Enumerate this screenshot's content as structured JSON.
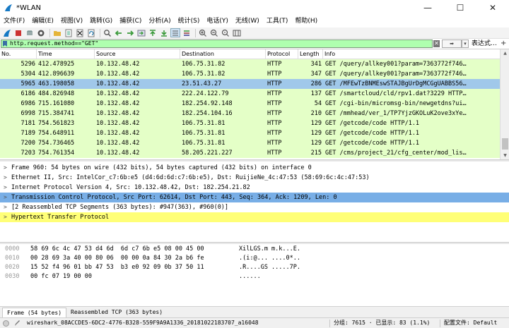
{
  "window": {
    "title": "*WLAN",
    "minimize": "—",
    "maximize": "☐",
    "close": "✕"
  },
  "menu": [
    "文件(F)",
    "编辑(E)",
    "视图(V)",
    "跳转(G)",
    "捕获(C)",
    "分析(A)",
    "统计(S)",
    "电话(Y)",
    "无线(W)",
    "工具(T)",
    "帮助(H)"
  ],
  "filter": {
    "value": "http.request.method==\"GET\"",
    "clear_label": "✕",
    "arrow_label": "➡",
    "dropdown_label": "▾",
    "expression_label": "表达式…",
    "plus_label": "+"
  },
  "columns": [
    "No.",
    "Time",
    "Source",
    "Destination",
    "Protocol",
    "Length",
    "Info"
  ],
  "packets": [
    {
      "no": "5296",
      "time": "412.478925",
      "src": "10.132.48.42",
      "dst": "106.75.31.82",
      "proto": "HTTP",
      "len": "341",
      "info": "GET /query/allkey001?param=7363772f746…",
      "selected": false
    },
    {
      "no": "5304",
      "time": "412.896639",
      "src": "10.132.48.42",
      "dst": "106.75.31.82",
      "proto": "HTTP",
      "len": "347",
      "info": "GET /query/allkey001?param=7363772f746…",
      "selected": false
    },
    {
      "no": "5965",
      "time": "463.198058",
      "src": "10.132.48.42",
      "dst": "23.51.43.27",
      "proto": "HTTP",
      "len": "286",
      "info": "GET /MFEwTzBNMEswSTAJBgUrDgMCGgUABBS56…",
      "selected": true
    },
    {
      "no": "6186",
      "time": "484.826948",
      "src": "10.132.48.42",
      "dst": "222.24.122.79",
      "proto": "HTTP",
      "len": "137",
      "info": "GET /smartcloud/cld/rpv1.dat?3229 HTTP…",
      "selected": false
    },
    {
      "no": "6986",
      "time": "715.161080",
      "src": "10.132.48.42",
      "dst": "182.254.92.148",
      "proto": "HTTP",
      "len": "54",
      "info": "GET /cgi-bin/micromsg-bin/newgetdns?ui…",
      "selected": false
    },
    {
      "no": "6998",
      "time": "715.384741",
      "src": "10.132.48.42",
      "dst": "182.254.104.16",
      "proto": "HTTP",
      "len": "210",
      "info": "GET /mmhead/ver_1/TP7YjzGKOLuK2ove3xYe…",
      "selected": false
    },
    {
      "no": "7181",
      "time": "754.561823",
      "src": "10.132.48.42",
      "dst": "106.75.31.81",
      "proto": "HTTP",
      "len": "129",
      "info": "GET /getcode/code HTTP/1.1",
      "selected": false
    },
    {
      "no": "7189",
      "time": "754.648911",
      "src": "10.132.48.42",
      "dst": "106.75.31.81",
      "proto": "HTTP",
      "len": "129",
      "info": "GET /getcode/code HTTP/1.1",
      "selected": false
    },
    {
      "no": "7200",
      "time": "754.736465",
      "src": "10.132.48.42",
      "dst": "106.75.31.81",
      "proto": "HTTP",
      "len": "129",
      "info": "GET /getcode/code HTTP/1.1",
      "selected": false
    },
    {
      "no": "7203",
      "time": "754.761354",
      "src": "10.132.48.42",
      "dst": "58.205.221.227",
      "proto": "HTTP",
      "len": "215",
      "info": "GET /cms/project_21/cfg_center/mod_lis…",
      "selected": false
    }
  ],
  "details": [
    {
      "text": "Frame 960: 54 bytes on wire (432 bits), 54 bytes captured (432 bits) on interface 0",
      "arrow": ">",
      "style": ""
    },
    {
      "text": "Ethernet II, Src: IntelCor_c7:6b:e5 (d4:6d:6d:c7:6b:e5), Dst: RuijieNe_4c:47:53 (58:69:6c:4c:47:53)",
      "arrow": ">",
      "style": ""
    },
    {
      "text": "Internet Protocol Version 4, Src: 10.132.48.42, Dst: 182.254.21.82",
      "arrow": ">",
      "style": ""
    },
    {
      "text": "Transmission Control Protocol, Src Port: 62614, Dst Port: 443, Seq: 364, Ack: 1209, Len: 0",
      "arrow": ">",
      "style": "hl"
    },
    {
      "text": "[2 Reassembled TCP Segments (363 bytes): #947(363), #960(0)]",
      "arrow": ">",
      "style": ""
    },
    {
      "text": "Hypertext Transfer Protocol",
      "arrow": ">",
      "style": "yel"
    }
  ],
  "bytes": [
    {
      "offset": "0000",
      "hex": "58 69 6c 4c 47 53 d4 6d  6d c7 6b e5 08 00 45 00",
      "ascii": "XilLGS.m m.k...E."
    },
    {
      "offset": "0010",
      "hex": "00 28 69 3a 40 00 80 06  00 00 0a 84 30 2a b6 fe",
      "ascii": ".(i:@... ....0*.."
    },
    {
      "offset": "0020",
      "hex": "15 52 f4 96 01 bb 47 53  b3 e0 92 09 0b 37 50 11",
      "ascii": ".R....GS .....7P."
    },
    {
      "offset": "0030",
      "hex": "00 fc 07 19 00 00",
      "ascii": "......"
    }
  ],
  "byte_tabs": [
    "Frame (54 bytes)",
    "Reassembled TCP (363 bytes)"
  ],
  "status": {
    "file": "wireshark_08ACCDE5-6DC2-4776-B328-559F9A9A1336_20181022183707_a16048",
    "stats": "分组: 7615 · 已显示: 83 (1.1%)",
    "profile": "配置文件: Default"
  },
  "colors": {
    "row_http": "#e4ffc7",
    "row_selected": "#a0c8ea",
    "detail_highlight": "#78aee6",
    "detail_yellow": "#ffff77",
    "filter_valid": "#afffaf"
  }
}
